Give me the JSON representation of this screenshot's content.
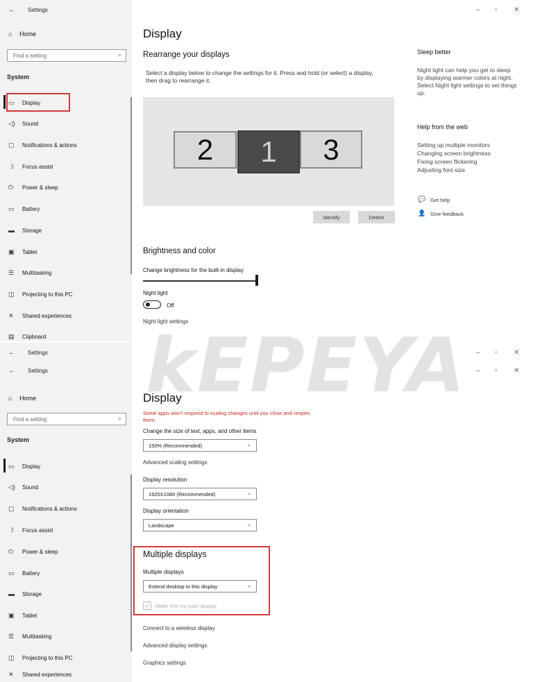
{
  "window": {
    "title": "Settings",
    "controls": {
      "minimize": "–",
      "restore": "▫",
      "close": "✕"
    }
  },
  "sidebar": {
    "home": "Home",
    "search_placeholder": "Find a setting",
    "section": "System",
    "items": [
      {
        "label": "Display",
        "icon": "monitor-icon"
      },
      {
        "label": "Sound",
        "icon": "speaker-icon"
      },
      {
        "label": "Notifications & actions",
        "icon": "notifications-icon"
      },
      {
        "label": "Focus assist",
        "icon": "moon-icon"
      },
      {
        "label": "Power & sleep",
        "icon": "power-icon"
      },
      {
        "label": "Battery",
        "icon": "battery-icon"
      },
      {
        "label": "Storage",
        "icon": "storage-icon"
      },
      {
        "label": "Tablet",
        "icon": "tablet-icon"
      },
      {
        "label": "Multitasking",
        "icon": "multitasking-icon"
      },
      {
        "label": "Projecting to this PC",
        "icon": "projecting-icon"
      },
      {
        "label": "Shared experiences",
        "icon": "shared-icon"
      },
      {
        "label": "Clipboard",
        "icon": "clipboard-icon"
      }
    ]
  },
  "top": {
    "page_title": "Display",
    "rearrange_heading": "Rearrange your displays",
    "rearrange_desc_1": "Select a display below to change the settings for it. Press and hold (or select) a display,",
    "rearrange_desc_2": "then drag to rearrange it.",
    "monitors": [
      "2",
      "1",
      "3"
    ],
    "identify_button": "Identify",
    "detect_button": "Detect",
    "brightness_heading": "Brightness and color",
    "brightness_label": "Change brightness for the built-in display",
    "brightness_level_percent": 100,
    "night_light_label": "Night light",
    "night_light_state": "Off",
    "night_light_settings_link": "Night light settings"
  },
  "right_panel": {
    "sleep_heading": "Sleep better",
    "sleep_text_1": "Night light can help you get to sleep",
    "sleep_text_2": "by displaying warmer colors at night.",
    "sleep_text_3": "Select Night light settings to set things",
    "sleep_text_4": "up.",
    "help_heading": "Help from the web",
    "links": [
      "Setting up multiple monitors",
      "Changing screen brightness",
      "Fixing screen flickering",
      "Adjusting font size"
    ],
    "get_help": "Get help",
    "give_feedback": "Give feedback"
  },
  "bottom": {
    "page_title": "Display",
    "warning_1": "Some apps won't respond to scaling changes until you close and reopen",
    "warning_2": "them.",
    "scale_label": "Change the size of text, apps, and other items",
    "scale_value": "150% (Recommended)",
    "advanced_scaling_link": "Advanced scaling settings",
    "resolution_label": "Display resolution",
    "resolution_value": "1920X1080 (Recommended)",
    "orientation_label": "Display orientation",
    "orientation_value": "Landscape",
    "multiple_heading": "Multiple displays",
    "multiple_label": "Multiple displays",
    "multiple_value": "Extend desktop to this display",
    "main_display_label": "Make this my main display",
    "wireless_link": "Connect to a wireless display",
    "advanced_display_link": "Advanced display settings",
    "graphics_link": "Graphics settings"
  },
  "watermark": "kEPEYA",
  "colors": {
    "highlight_box": "#d03a3a",
    "warning_text": "#c42b1c",
    "sidebar_bg": "#f2f2f2"
  }
}
